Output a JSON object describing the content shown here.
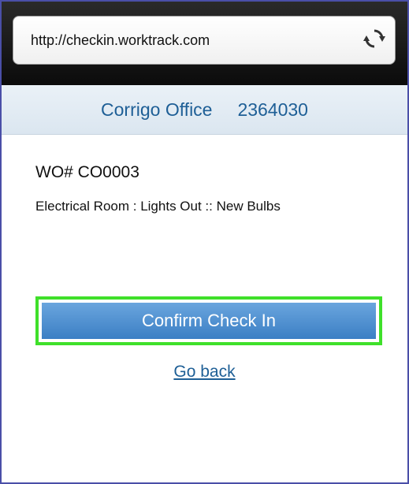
{
  "browser": {
    "url": "http://checkin.worktrack.com",
    "reload_icon": "reload-icon"
  },
  "header": {
    "company": "Corrigo Office",
    "code": "2364030"
  },
  "work_order": {
    "number": "WO# CO0003",
    "description": "Electrical Room : Lights Out :: New Bulbs"
  },
  "actions": {
    "confirm_label": "Confirm Check In",
    "back_label": "Go back"
  },
  "colors": {
    "accent": "#1e5f96",
    "button": "#4a8fd2",
    "highlight_outline": "#3fe02a"
  }
}
